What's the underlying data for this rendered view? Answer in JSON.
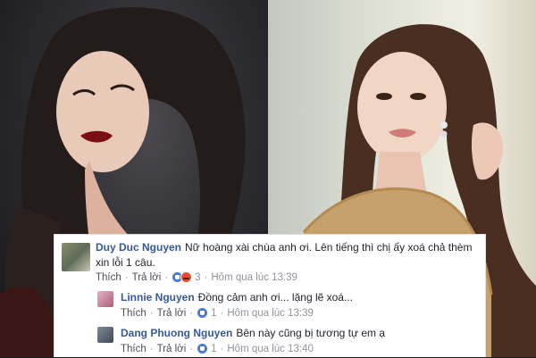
{
  "comments": [
    {
      "author": "Duy Duc Nguyen",
      "text": "Nữ hoàng xài chùa anh ơi. Lên tiếng thì chị ấy xoá chả thèm xin lỗi 1 câu.",
      "like_label": "Thích",
      "reply_label": "Trả lời",
      "reaction_count": "3",
      "timestamp": "Hôm qua lúc 13:39",
      "reactions": [
        "like-icon",
        "angry-icon"
      ]
    },
    {
      "author": "Linnie Nguyen",
      "text": "Đồng cảm anh ơi... lặng lẽ xoá...",
      "like_label": "Thích",
      "reply_label": "Trả lời",
      "reaction_count": "1",
      "timestamp": "Hôm qua lúc 13:39",
      "reactions": [
        "like-icon"
      ]
    },
    {
      "author": "Dang Phuong Nguyen",
      "text": "Bên này cũng bị tương tự em ạ",
      "like_label": "Thích",
      "reply_label": "Trả lời",
      "reaction_count": "1",
      "timestamp": "Hôm qua lúc 13:40",
      "reactions": [
        "like-icon"
      ]
    }
  ],
  "colors": {
    "author_link": "#365899",
    "meta_text": "#90949c",
    "like_blue": "#4a78d8",
    "angry_orange": "#e0502e"
  }
}
